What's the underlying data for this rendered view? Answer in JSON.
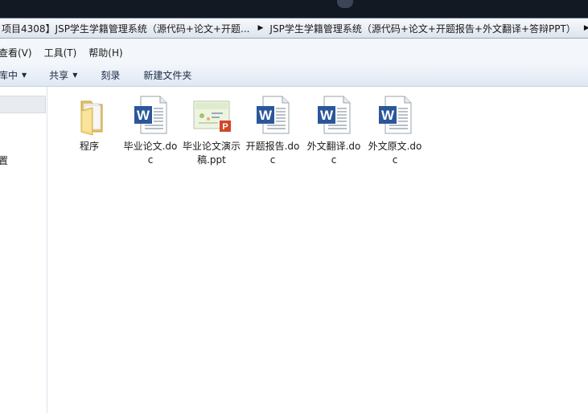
{
  "address_bar": {
    "crumbs": [
      "项目4308】JSP学生学籍管理系统（源代码+论文+开题...",
      "JSP学生学籍管理系统（源代码+论文+开题报告+外文翻译+答辩PPT）"
    ]
  },
  "menu": {
    "items": [
      "查看(V)",
      "工具(T)",
      "帮助(H)"
    ]
  },
  "toolbar": {
    "library": "库中",
    "share": "共享",
    "burn": "刻录",
    "new_folder": "新建文件夹"
  },
  "nav": {
    "partial_label": "置"
  },
  "files": [
    {
      "name": "程序",
      "type": "folder",
      "icon": "folder-icon"
    },
    {
      "name": "毕业论文.doc",
      "type": "doc",
      "icon": "word-document-icon"
    },
    {
      "name": "毕业论文演示稿.ppt",
      "type": "ppt",
      "icon": "powerpoint-document-icon"
    },
    {
      "name": "开题报告.doc",
      "type": "doc",
      "icon": "word-document-icon"
    },
    {
      "name": "外文翻译.doc",
      "type": "doc",
      "icon": "word-document-icon"
    },
    {
      "name": "外文原文.doc",
      "type": "doc",
      "icon": "word-document-icon"
    }
  ],
  "colors": {
    "title_strip": "#121923",
    "word_blue": "#2b579a",
    "ppt_orange": "#d24726",
    "folder_yellow": "#f4d57a"
  }
}
